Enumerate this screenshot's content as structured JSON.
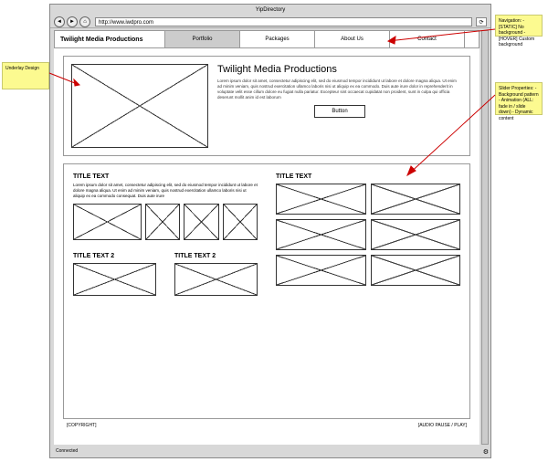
{
  "browser": {
    "title": "YipDirectory",
    "url": "http://www.iwdpro.com",
    "status": "Connected"
  },
  "header": {
    "logo": "Twilight Media Productions",
    "nav": [
      "Portfolio",
      "Packages",
      "About Us",
      "Contact"
    ]
  },
  "hero": {
    "title": "Twilight Media Productions",
    "body": "Lorem ipsum dolor sit amet, consectetur adipiscing elit, sed do eiusmod tempor incididunt ut labore et dolore magna aliqua. Ut enim ad minim veniam, quis nostrud exercitation ullamco laboris nisi ut aliquip ex ea commodo. Duis aute irure dolor in reprehenderit in voluptate velit esse cillum dolore eu fugiat nulla pariatur. Excepteur sint occaecat cupidatat non proident, sunt in culpa qui officia deserunt mollit anim id est laborum",
    "button": "Button"
  },
  "left": {
    "s1": {
      "title": "TITLE TEXT",
      "body": "Lorem ipsum dolor sit amet, consectetur adipiscing elit, sed do eiusmod tempor incididunt ut labore et dolore magna aliqua. Ut enim ad minim veniam, quis nostrud exercitation ullamco laboris nisi ut aliquip ex ea commodo consequat. Duis aute irure"
    },
    "s2a": "TITLE TEXT 2",
    "s2b": "TITLE TEXT 2"
  },
  "right": {
    "title": "TITLE TEXT"
  },
  "footer": {
    "copyright": "[COPYRIGHT]",
    "audio": "[AUDIO PAUSE / PLAY]"
  },
  "notes": {
    "underlay": "Underlay Design",
    "nav": "Navigation:\n- [STATIC] No background\n- [HOVER] Custom background",
    "slider": "Slider Properties:\n- Background pattern\n- Animation (ALL: fade in / slide down)\n- Dynamic content"
  }
}
